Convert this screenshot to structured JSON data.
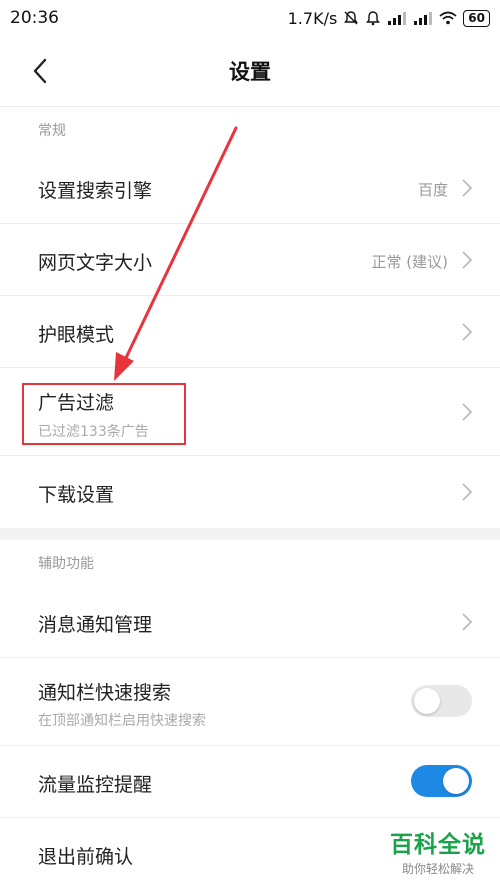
{
  "status_bar": {
    "time": "20:36",
    "net_speed": "1.7K/s",
    "battery": "60"
  },
  "header": {
    "title": "设置"
  },
  "sections": [
    {
      "title": "常规",
      "items": [
        {
          "label": "设置搜索引擎",
          "value": "百度",
          "control": "chevron"
        },
        {
          "label": "网页文字大小",
          "value": "正常 (建议)",
          "control": "chevron"
        },
        {
          "label": "护眼模式",
          "control": "chevron"
        },
        {
          "label": "广告过滤",
          "subtitle": "已过滤133条广告",
          "control": "chevron"
        },
        {
          "label": "下载设置",
          "control": "chevron"
        }
      ]
    },
    {
      "title": "辅助功能",
      "items": [
        {
          "label": "消息通知管理",
          "control": "chevron"
        },
        {
          "label": "通知栏快速搜索",
          "subtitle": "在顶部通知栏启用快速搜索",
          "control": "toggle",
          "enabled": false
        },
        {
          "label": "流量监控提醒",
          "control": "toggle",
          "enabled": true
        },
        {
          "label": "退出前确认"
        }
      ]
    }
  ],
  "watermark": {
    "title": "百科全说",
    "subtitle": "助你轻松解决"
  },
  "colors": {
    "toggle_on": "#1e88e5",
    "highlight": "#e8343a",
    "watermark": "#1aa34a"
  }
}
